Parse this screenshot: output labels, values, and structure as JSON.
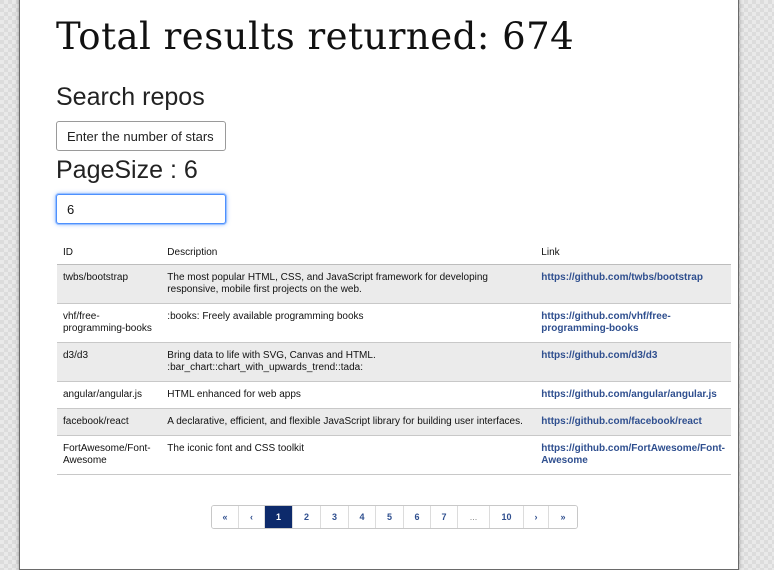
{
  "total_label": "Total results returned: 674",
  "search": {
    "title": "Search repos",
    "placeholder": "Enter the number of stars",
    "value": ""
  },
  "pagesize": {
    "title": "PageSize : 6",
    "value": "6"
  },
  "table": {
    "headers": {
      "id": "ID",
      "description": "Description",
      "link": "Link"
    },
    "rows": [
      {
        "id": "twbs/bootstrap",
        "description": "The most popular HTML, CSS, and JavaScript framework for developing responsive, mobile first projects on the web.",
        "link": "https://github.com/twbs/bootstrap"
      },
      {
        "id": "vhf/free-programming-books",
        "description": ":books: Freely available programming books",
        "link": "https://github.com/vhf/free-programming-books"
      },
      {
        "id": "d3/d3",
        "description": "Bring data to life with SVG, Canvas and HTML. :bar_chart::chart_with_upwards_trend::tada:",
        "link": "https://github.com/d3/d3"
      },
      {
        "id": "angular/angular.js",
        "description": "HTML enhanced for web apps",
        "link": "https://github.com/angular/angular.js"
      },
      {
        "id": "facebook/react",
        "description": "A declarative, efficient, and flexible JavaScript library for building user interfaces.",
        "link": "https://github.com/facebook/react"
      },
      {
        "id": "FortAwesome/Font-Awesome",
        "description": "The iconic font and CSS toolkit",
        "link": "https://github.com/FortAwesome/Font-Awesome"
      }
    ]
  },
  "pagination": {
    "first": "«",
    "prev": "‹",
    "pages": [
      "1",
      "2",
      "3",
      "4",
      "5",
      "6",
      "7"
    ],
    "ellipsis": "...",
    "last_page": "10",
    "next": "›",
    "last": "»",
    "current": "1"
  },
  "colors": {
    "link": "#2f4f8f",
    "active_page": "#0d2a6b",
    "focus_ring": "#4d90fe"
  }
}
